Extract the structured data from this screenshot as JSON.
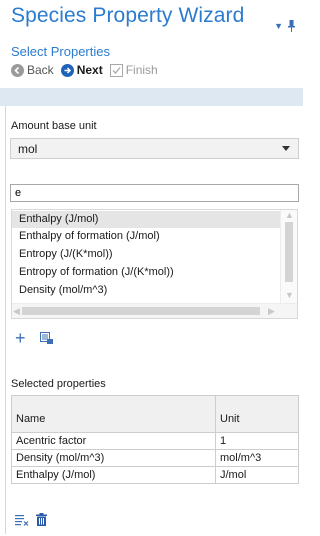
{
  "header": {
    "title": "Species Property Wizard",
    "subtitle": "Select Properties",
    "back_label": "Back",
    "next_label": "Next",
    "finish_label": "Finish"
  },
  "amount": {
    "label": "Amount base unit",
    "value": "mol"
  },
  "search": {
    "value": "e"
  },
  "property_list": [
    "Enthalpy (J/mol)",
    "Enthalpy of formation (J/mol)",
    "Entropy (J/(K*mol))",
    "Entropy of formation (J/(K*mol))",
    "Density (mol/m^3)"
  ],
  "selected": {
    "label": "Selected properties",
    "col_name": "Name",
    "col_unit": "Unit",
    "rows": [
      {
        "name": "Acentric factor",
        "unit": "1"
      },
      {
        "name": "Density (mol/m^3)",
        "unit": "mol/m^3"
      },
      {
        "name": "Enthalpy (J/mol)",
        "unit": "J/mol"
      }
    ]
  },
  "icons": {
    "add": "plus-icon",
    "add_list": "add-to-list-icon",
    "clear": "clear-list-icon",
    "delete": "trash-icon",
    "pin": "pin-icon",
    "menu": "dropdown-icon"
  },
  "colors": {
    "accent": "#2b7bcf",
    "next": "#1f63b8",
    "band": "#dde8f3"
  }
}
